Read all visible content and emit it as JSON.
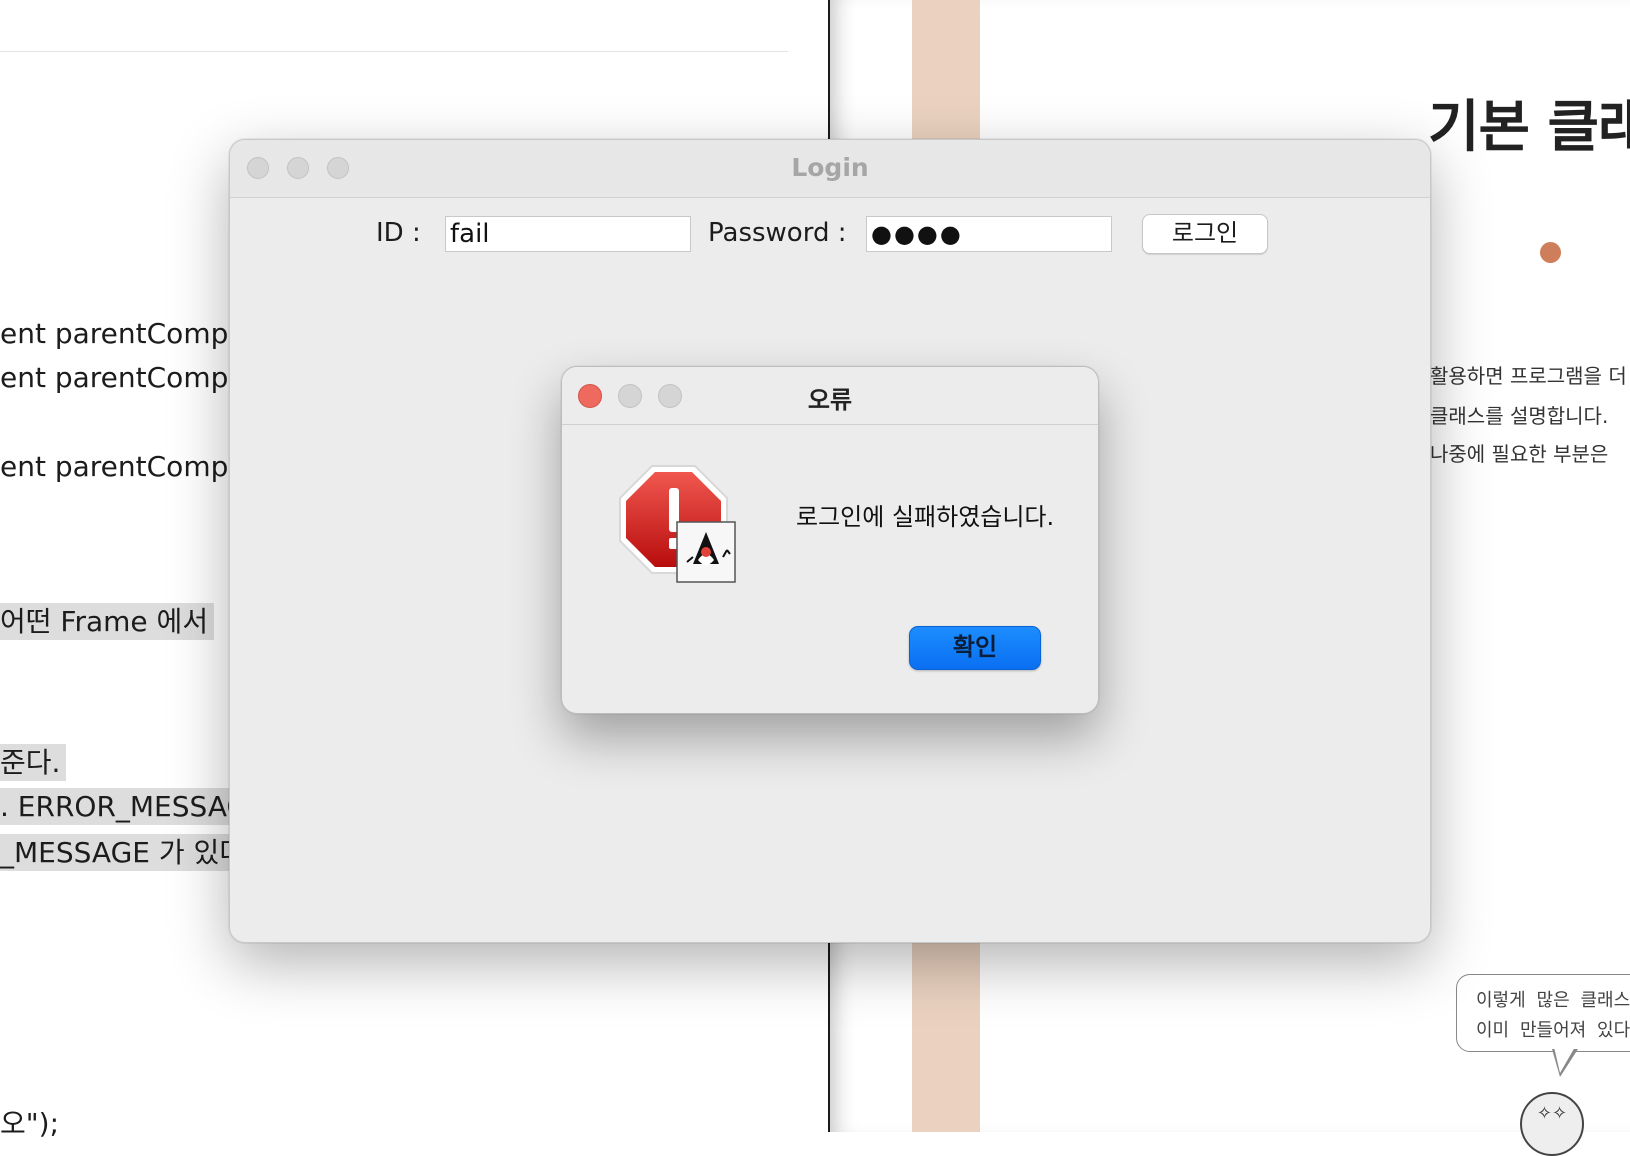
{
  "background_document": {
    "lines": [
      {
        "text": "ent parentCompo",
        "highlight": false
      },
      {
        "text": "ent parentCompo",
        "highlight": false
      },
      {
        "text": "ent parentCompo",
        "highlight": false
      },
      {
        "text": " 어떤 Frame 에서",
        "highlight": true
      },
      {
        "text": "준다.",
        "highlight": true
      },
      {
        "text": ". ERROR_MESSAG",
        "highlight": true
      },
      {
        "text": "_MESSAGE 가 있다",
        "highlight": true
      },
      {
        "text": "오\");",
        "highlight": false
      }
    ]
  },
  "book_page": {
    "title": "기본 클래스",
    "paragraph": [
      "활용하면 프로그램을 더",
      "클래스를 설명합니다.",
      "나중에 필요한 부분은"
    ],
    "speech_bubble": [
      "이렇게 많은 클래스",
      "이미 만들어져 있다"
    ],
    "accent_color": "#cf7e5c"
  },
  "login_window": {
    "title": "Login",
    "id_label": "ID :",
    "id_value": "fail",
    "password_label": "Password :",
    "password_masked": "●●●●",
    "login_button": "로그인"
  },
  "error_dialog": {
    "title": "오류",
    "icon": "error-stop-icon",
    "message": "로그인에 실패하였습니다.",
    "ok_button": "확인",
    "ok_button_color": "#0a7aff"
  }
}
